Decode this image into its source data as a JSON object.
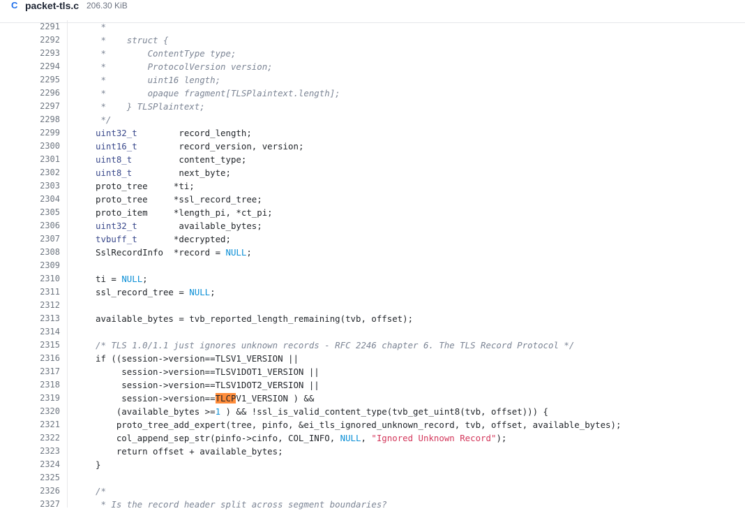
{
  "file": {
    "lang_badge": "C",
    "name": "packet-tls.c",
    "size": "206.30 KiB"
  },
  "colors": {
    "comment": "#7b8494",
    "type": "#3b4a8c",
    "constant": "#0b8fd6",
    "string": "#d3375b",
    "search_highlight": "#ff8c3a"
  },
  "lines": [
    {
      "n": "2291",
      "t": [
        {
          "c": "cm",
          "s": " *"
        }
      ]
    },
    {
      "n": "2292",
      "t": [
        {
          "c": "cm",
          "s": " *    struct {"
        }
      ]
    },
    {
      "n": "2293",
      "t": [
        {
          "c": "cm",
          "s": " *        ContentType type;"
        }
      ]
    },
    {
      "n": "2294",
      "t": [
        {
          "c": "cm",
          "s": " *        ProtocolVersion version;"
        }
      ]
    },
    {
      "n": "2295",
      "t": [
        {
          "c": "cm",
          "s": " *        uint16 length;"
        }
      ]
    },
    {
      "n": "2296",
      "t": [
        {
          "c": "cm",
          "s": " *        opaque fragment[TLSPlaintext.length];"
        }
      ]
    },
    {
      "n": "2297",
      "t": [
        {
          "c": "cm",
          "s": " *    } TLSPlaintext;"
        }
      ]
    },
    {
      "n": "2298",
      "t": [
        {
          "c": "cm",
          "s": " */"
        }
      ]
    },
    {
      "n": "2299",
      "t": [
        {
          "c": "ty",
          "s": "uint32_t"
        },
        {
          "c": "",
          "s": "        record_length;"
        }
      ]
    },
    {
      "n": "2300",
      "t": [
        {
          "c": "ty",
          "s": "uint16_t"
        },
        {
          "c": "",
          "s": "        record_version, version;"
        }
      ]
    },
    {
      "n": "2301",
      "t": [
        {
          "c": "ty",
          "s": "uint8_t"
        },
        {
          "c": "",
          "s": "         content_type;"
        }
      ]
    },
    {
      "n": "2302",
      "t": [
        {
          "c": "ty",
          "s": "uint8_t"
        },
        {
          "c": "",
          "s": "         next_byte;"
        }
      ]
    },
    {
      "n": "2303",
      "t": [
        {
          "c": "",
          "s": "proto_tree     *ti;"
        }
      ]
    },
    {
      "n": "2304",
      "t": [
        {
          "c": "",
          "s": "proto_tree     *ssl_record_tree;"
        }
      ]
    },
    {
      "n": "2305",
      "t": [
        {
          "c": "",
          "s": "proto_item     *length_pi, *ct_pi;"
        }
      ]
    },
    {
      "n": "2306",
      "t": [
        {
          "c": "ty",
          "s": "uint32_t"
        },
        {
          "c": "",
          "s": "        available_bytes;"
        }
      ]
    },
    {
      "n": "2307",
      "t": [
        {
          "c": "ty",
          "s": "tvbuff_t"
        },
        {
          "c": "",
          "s": "       *decrypted;"
        }
      ]
    },
    {
      "n": "2308",
      "t": [
        {
          "c": "",
          "s": "SslRecordInfo  *record = "
        },
        {
          "c": "nu",
          "s": "NULL"
        },
        {
          "c": "",
          "s": ";"
        }
      ]
    },
    {
      "n": "2309",
      "t": []
    },
    {
      "n": "2310",
      "t": [
        {
          "c": "",
          "s": "ti = "
        },
        {
          "c": "nu",
          "s": "NULL"
        },
        {
          "c": "",
          "s": ";"
        }
      ]
    },
    {
      "n": "2311",
      "t": [
        {
          "c": "",
          "s": "ssl_record_tree = "
        },
        {
          "c": "nu",
          "s": "NULL"
        },
        {
          "c": "",
          "s": ";"
        }
      ]
    },
    {
      "n": "2312",
      "t": []
    },
    {
      "n": "2313",
      "t": [
        {
          "c": "",
          "s": "available_bytes = tvb_reported_length_remaining(tvb, offset);"
        }
      ]
    },
    {
      "n": "2314",
      "t": []
    },
    {
      "n": "2315",
      "t": [
        {
          "c": "cm",
          "s": "/* TLS 1.0/1.1 just ignores unknown records - RFC 2246 chapter 6. The TLS Record Protocol */"
        }
      ]
    },
    {
      "n": "2316",
      "t": [
        {
          "c": "",
          "s": "if ((session->version==TLSV1_VERSION ||"
        }
      ]
    },
    {
      "n": "2317",
      "t": [
        {
          "c": "",
          "s": "     session->version==TLSV1DOT1_VERSION ||"
        }
      ]
    },
    {
      "n": "2318",
      "t": [
        {
          "c": "",
          "s": "     session->version==TLSV1DOT2_VERSION ||"
        }
      ]
    },
    {
      "n": "2319",
      "t": [
        {
          "c": "",
          "s": "     session->version=="
        },
        {
          "c": "mark",
          "s": "TLCP"
        },
        {
          "c": "",
          "s": "V1_VERSION ) &&"
        }
      ]
    },
    {
      "n": "2320",
      "t": [
        {
          "c": "",
          "s": "    (available_bytes >="
        },
        {
          "c": "nu",
          "s": "1"
        },
        {
          "c": "",
          "s": " ) && !ssl_is_valid_content_type(tvb_get_uint8(tvb, offset))) {"
        }
      ]
    },
    {
      "n": "2321",
      "t": [
        {
          "c": "",
          "s": "    proto_tree_add_expert(tree, pinfo, &ei_tls_ignored_unknown_record, tvb, offset, available_bytes);"
        }
      ]
    },
    {
      "n": "2322",
      "t": [
        {
          "c": "",
          "s": "    col_append_sep_str(pinfo->cinfo, COL_INFO, "
        },
        {
          "c": "nu",
          "s": "NULL"
        },
        {
          "c": "",
          "s": ", "
        },
        {
          "c": "st",
          "s": "\"Ignored Unknown Record\""
        },
        {
          "c": "",
          "s": ");"
        }
      ]
    },
    {
      "n": "2323",
      "t": [
        {
          "c": "",
          "s": "    return offset + available_bytes;"
        }
      ]
    },
    {
      "n": "2324",
      "t": [
        {
          "c": "",
          "s": "}"
        }
      ]
    },
    {
      "n": "2325",
      "t": []
    },
    {
      "n": "2326",
      "t": [
        {
          "c": "cm",
          "s": "/*"
        }
      ]
    },
    {
      "n": "2327",
      "t": [
        {
          "c": "cm",
          "s": " * Is the record header split across segment boundaries?"
        }
      ]
    }
  ]
}
